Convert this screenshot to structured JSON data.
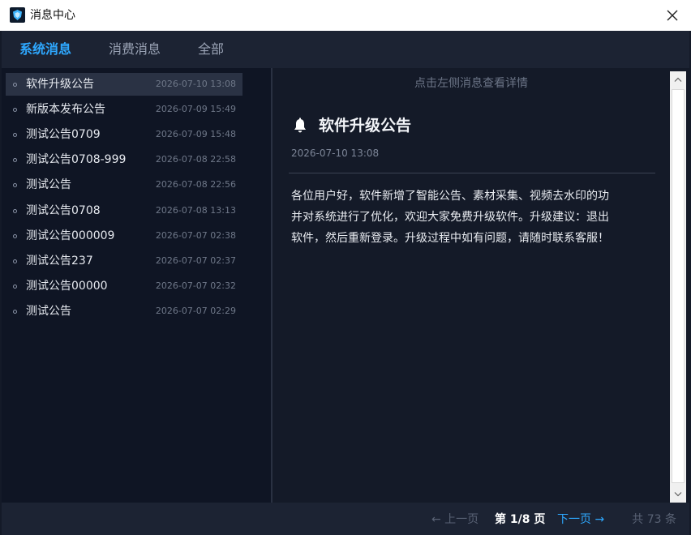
{
  "window": {
    "title": "消息中心"
  },
  "tabs": [
    {
      "label": "系统消息",
      "active": true
    },
    {
      "label": "消费消息",
      "active": false
    },
    {
      "label": "全部",
      "active": false
    }
  ],
  "messages": [
    {
      "title": "软件升级公告",
      "date": "2026-07-10 13:08",
      "selected": true
    },
    {
      "title": "新版本发布公告",
      "date": "2026-07-09 15:49"
    },
    {
      "title": "测试公告0709",
      "date": "2026-07-09 15:48"
    },
    {
      "title": "测试公告0708-999",
      "date": "2026-07-08 22:58"
    },
    {
      "title": "测试公告",
      "date": "2026-07-08 22:56"
    },
    {
      "title": "测试公告0708",
      "date": "2026-07-08 13:13"
    },
    {
      "title": "测试公告000009",
      "date": "2026-07-07 02:38"
    },
    {
      "title": "测试公告237",
      "date": "2026-07-07 02:37"
    },
    {
      "title": "测试公告00000",
      "date": "2026-07-07 02:32"
    },
    {
      "title": "测试公告",
      "date": "2026-07-07 02:29"
    }
  ],
  "detail": {
    "hint": "点击左侧消息查看详情",
    "title": "软件升级公告",
    "date": "2026-07-10 13:08",
    "body_lines": [
      "各位用户好，软件新增了智能公告、素材采集、视频去水印的功",
      "并对系统进行了优化，欢迎大家免费升级软件。升级建议：退出",
      "软件，然后重新登录。升级过程中如有问题，请随时联系客服！"
    ]
  },
  "pagination": {
    "prev": "← 上一页",
    "current": "第 1/8 页",
    "next": "下一页 →",
    "total": "共 73 条"
  },
  "colors": {
    "accent": "#2ea8ff",
    "background": "#141a28",
    "list_background": "#0f1524",
    "selected_row": "#2a3244"
  },
  "icons": {
    "app": "app-logo-icon",
    "close": "close-icon",
    "bell": "bell-icon",
    "scroll_up": "chevron-up-icon",
    "scroll_down": "chevron-down-icon"
  }
}
